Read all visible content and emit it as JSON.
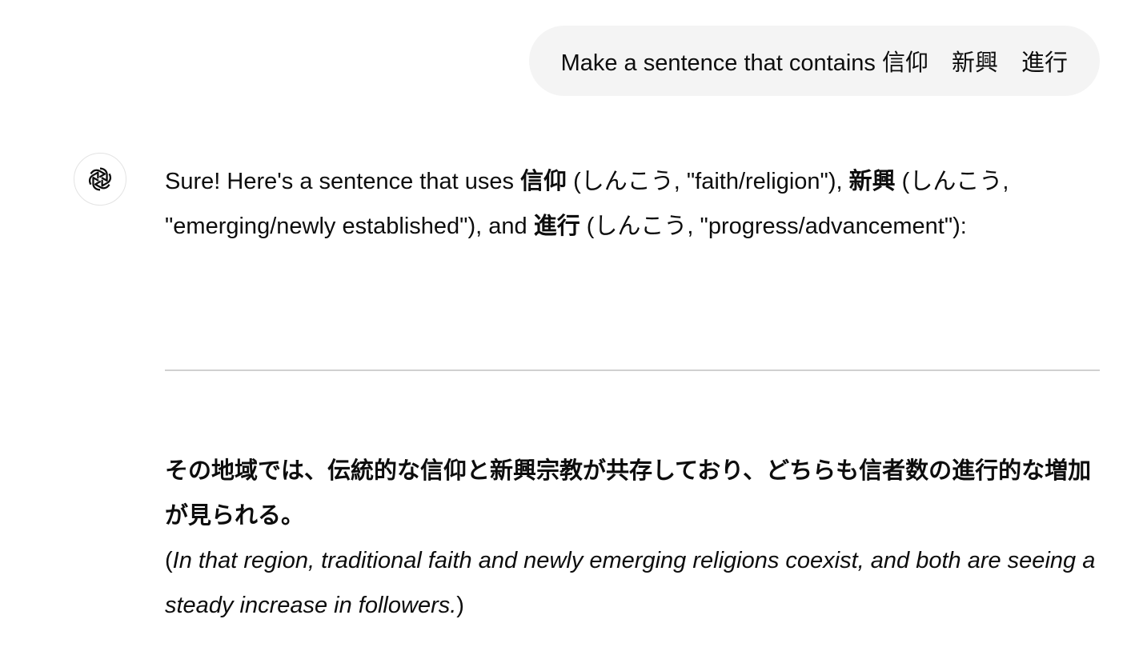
{
  "user_message": {
    "text": "Make a sentence that contains 信仰　新興　進行"
  },
  "assistant": {
    "avatar_icon": "openai-logo-icon",
    "intro": {
      "part1": "Sure! Here's a sentence that uses ",
      "word1": "信仰",
      "part2": " (しんこう, \"faith/religion\"), ",
      "word2": "新興",
      "part3": " (しんこう, \"emerging/newly established\"), and ",
      "word3": "進行",
      "part4": " (しんこう, \"progress/advancement\"):"
    },
    "example_sentence": "その地域では、伝統的な信仰と新興宗教が共存しており、どちらも信者数の進行的な増加が見られる。",
    "translation": {
      "open": "(",
      "text": "In that region, traditional faith and newly emerging religions coexist, and both are seeing a steady increase in followers.",
      "close": ")"
    }
  },
  "colors": {
    "user_bubble_bg": "#f4f4f4",
    "text": "#0d0d0d",
    "divider": "#d0d0d0"
  }
}
